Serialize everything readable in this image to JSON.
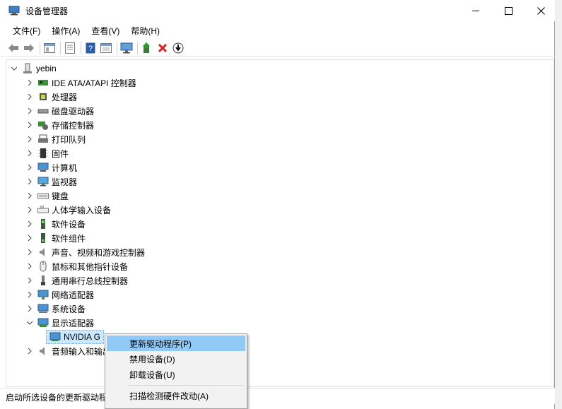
{
  "window": {
    "title": "设备管理器",
    "minimize": "—",
    "maximize": "☐",
    "close": "✕"
  },
  "menubar": {
    "items": [
      {
        "label": "文件(F)"
      },
      {
        "label": "操作(A)"
      },
      {
        "label": "查看(V)"
      },
      {
        "label": "帮助(H)"
      }
    ]
  },
  "toolbar": {
    "buttons": [
      "back-icon",
      "forward-icon",
      "show-hide-tree-icon",
      "properties-icon",
      "help-icon",
      "view-icon",
      "monitor-icon",
      "update-driver-icon",
      "uninstall-icon",
      "download-icon"
    ]
  },
  "tree": {
    "root": {
      "label": "yebin"
    },
    "categories": [
      {
        "label": "IDE ATA/ATAPI 控制器",
        "icon": "ide-controller-icon"
      },
      {
        "label": "处理器",
        "icon": "processor-icon"
      },
      {
        "label": "磁盘驱动器",
        "icon": "disk-drive-icon"
      },
      {
        "label": "存储控制器",
        "icon": "storage-controller-icon"
      },
      {
        "label": "打印队列",
        "icon": "printer-icon"
      },
      {
        "label": "固件",
        "icon": "firmware-icon"
      },
      {
        "label": "计算机",
        "icon": "computer-icon"
      },
      {
        "label": "监视器",
        "icon": "monitor-icon"
      },
      {
        "label": "键盘",
        "icon": "keyboard-icon"
      },
      {
        "label": "人体学输入设备",
        "icon": "hid-icon"
      },
      {
        "label": "软件设备",
        "icon": "software-device-icon"
      },
      {
        "label": "软件组件",
        "icon": "software-component-icon"
      },
      {
        "label": "声音、视频和游戏控制器",
        "icon": "sound-icon"
      },
      {
        "label": "鼠标和其他指针设备",
        "icon": "mouse-icon"
      },
      {
        "label": "通用串行总线控制器",
        "icon": "usb-icon"
      },
      {
        "label": "网络适配器",
        "icon": "network-adapter-icon"
      },
      {
        "label": "系统设备",
        "icon": "system-device-icon"
      },
      {
        "label": "显示适配器",
        "icon": "display-adapter-icon",
        "expanded": true
      },
      {
        "label": "音频输入和输出",
        "icon": "audio-io-icon"
      }
    ],
    "display_child": {
      "label": "NVIDIA G"
    }
  },
  "context_menu": {
    "items": [
      {
        "label": "更新驱动程序(P)",
        "highlighted": true
      },
      {
        "label": "禁用设备(D)"
      },
      {
        "label": "卸载设备(U)"
      },
      {
        "label": "扫描检测硬件改动(A)"
      }
    ]
  },
  "statusbar": {
    "text": "启动所选设备的更新驱动程"
  },
  "colors": {
    "highlight": "#91c9f7",
    "selection": "#cce8ff",
    "menu_bg": "#f2f2f2"
  }
}
